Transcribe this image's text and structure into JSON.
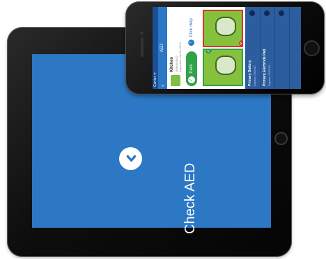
{
  "tablet": {
    "screen_color": "#2c78c5",
    "action_label": "Check AED",
    "action_icon": "chevron-right-icon"
  },
  "phone": {
    "status_left": "Carrier ᯤ",
    "nav": {
      "back_label": "‹",
      "title": "AED"
    },
    "item": {
      "name": "Kitchen",
      "serial": "2K8A0D4532",
      "inspected": "Inspected: Jun 28, 2014"
    },
    "actions": {
      "pass_label": "Pass",
      "help_label": "Click Help",
      "help_icon": "question-icon"
    },
    "photos": [
      {
        "status": "ok",
        "badge": "✓"
      },
      {
        "status": "bad",
        "badge": "✕"
      }
    ],
    "list": [
      {
        "title": "Primary Battery",
        "sub": "Expires: 09/2017"
      },
      {
        "title": "Primary Electrode Pad",
        "sub": "Expires: 01/2016"
      },
      {
        "title": "",
        "sub": ""
      }
    ]
  }
}
